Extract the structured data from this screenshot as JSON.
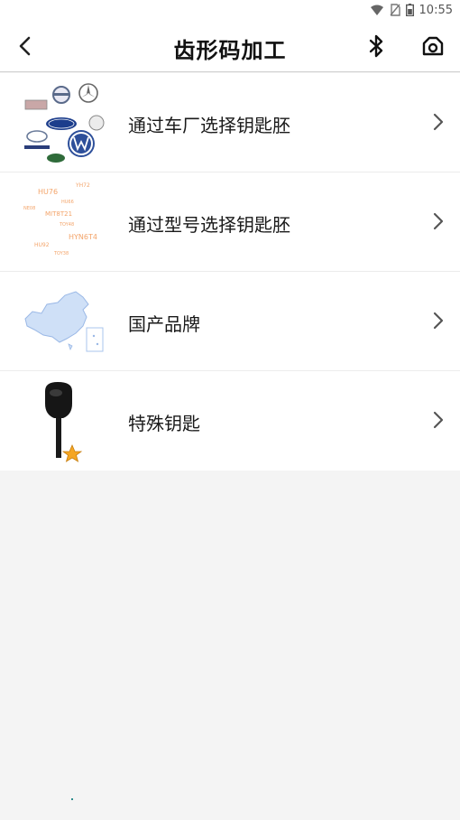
{
  "status_bar": {
    "time": "10:55"
  },
  "header": {
    "title": "齿形码加工",
    "back_icon": "chevron-left-icon",
    "bluetooth_icon": "bluetooth-icon",
    "camera_icon": "camera-icon"
  },
  "menu": {
    "items": [
      {
        "label": "通过车厂选择钥匙胚",
        "icon": "car-brand-logos-icon"
      },
      {
        "label": "通过型号选择钥匙胚",
        "icon": "key-model-codes-icon",
        "thumb_texts": [
          "HU76",
          "YH72",
          "HU66",
          "MIT8T21",
          "NE08",
          "TOY48",
          "HYN6T4",
          "HU92",
          "TOY38"
        ]
      },
      {
        "label": "国产品牌",
        "icon": "china-map-icon"
      },
      {
        "label": "特殊钥匙",
        "icon": "special-key-star-icon"
      }
    ],
    "chevron_icon": "chevron-right-icon"
  },
  "colors": {
    "header_bg": "#ffffff",
    "page_bg": "#f4f4f4",
    "model_code_text": "#f3a46a",
    "star": "#f5a623"
  }
}
